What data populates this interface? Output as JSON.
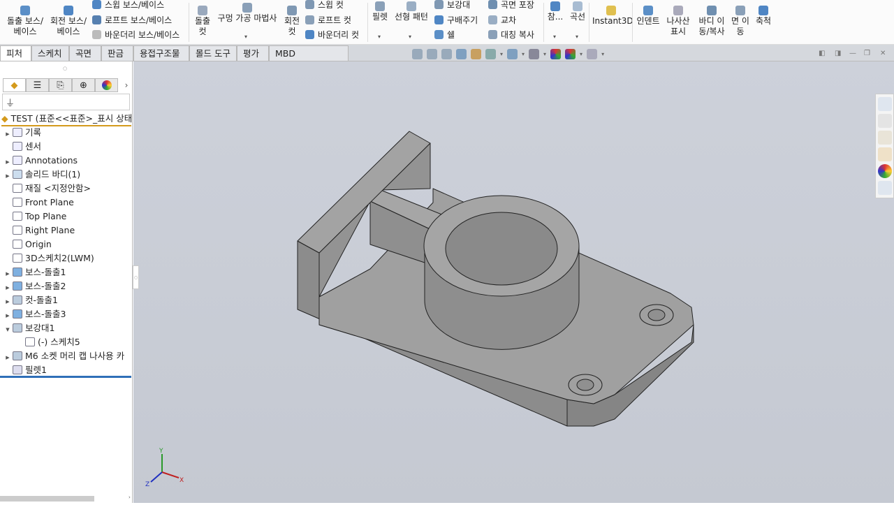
{
  "ribbon": {
    "extrude_boss": "돌출 보스/\n베이스",
    "revolve_boss": "회전 보스/\n베이스",
    "sweep_boss": "스윕 보스/베이스",
    "loft_boss": "로프트 보스/베이스",
    "boundary_boss": "바운더리 보스/베이스",
    "extrude_cut": "돌출\n컷",
    "hole_wizard": "구멍 가공 마법사",
    "revolve_cut": "회전\n컷",
    "sweep_cut": "스윕 컷",
    "loft_cut": "로프트 컷",
    "boundary_cut": "바운더리 컷",
    "fillet": "필렛",
    "linear_pattern": "선형 패턴",
    "rib": "보강대",
    "draft": "구배주기",
    "shell": "쉘",
    "wrap": "곡면 포장",
    "intersect": "교차",
    "mirror": "대칭 복사",
    "reference": "참...",
    "curves": "곡선",
    "instant3d": "Instant3D",
    "indent": "인덴트",
    "cosmetic_thread": "나사산\n표시",
    "move_copy_body": "바디 이\n동/복사",
    "move_face": "면 이\n동",
    "scale": "축척"
  },
  "tabs": [
    {
      "label": "피처",
      "active": true
    },
    {
      "label": "스케치"
    },
    {
      "label": "곡면"
    },
    {
      "label": "판금"
    },
    {
      "label": "용접구조물"
    },
    {
      "label": "몰드 도구"
    },
    {
      "label": "평가"
    },
    {
      "label": "MBD Dimensions"
    }
  ],
  "tree": {
    "root": "TEST  (표준<<표준>_표시 상태",
    "items": [
      {
        "label": "기록",
        "expand": true
      },
      {
        "label": "센서"
      },
      {
        "label": "Annotations",
        "expand": true
      },
      {
        "label": "솔리드 바디(1)",
        "expand": true
      },
      {
        "label": "재질 <지정안함>"
      },
      {
        "label": "Front Plane"
      },
      {
        "label": "Top Plane"
      },
      {
        "label": "Right Plane"
      },
      {
        "label": "Origin"
      },
      {
        "label": "3D스케치2(LWM)"
      },
      {
        "label": "보스-돌출1",
        "expand": true
      },
      {
        "label": "보스-돌출2",
        "expand": true
      },
      {
        "label": "컷-돌출1",
        "expand": true
      },
      {
        "label": "보스-돌출3",
        "expand": true
      },
      {
        "label": "보강대1",
        "expanded": true
      },
      {
        "label": "(-) 스케치5",
        "child": true
      },
      {
        "label": "M6 소켓 머리 캡 나사용 카",
        "expand": true
      },
      {
        "label": "필렛1"
      }
    ]
  },
  "triad": {
    "x": "X",
    "y": "Y",
    "z": "Z"
  },
  "colors": {
    "model": "#9a9a9a",
    "background": "#c8ccd5",
    "rollback": "#2f6fb8",
    "root_underline": "#d49a1c"
  }
}
